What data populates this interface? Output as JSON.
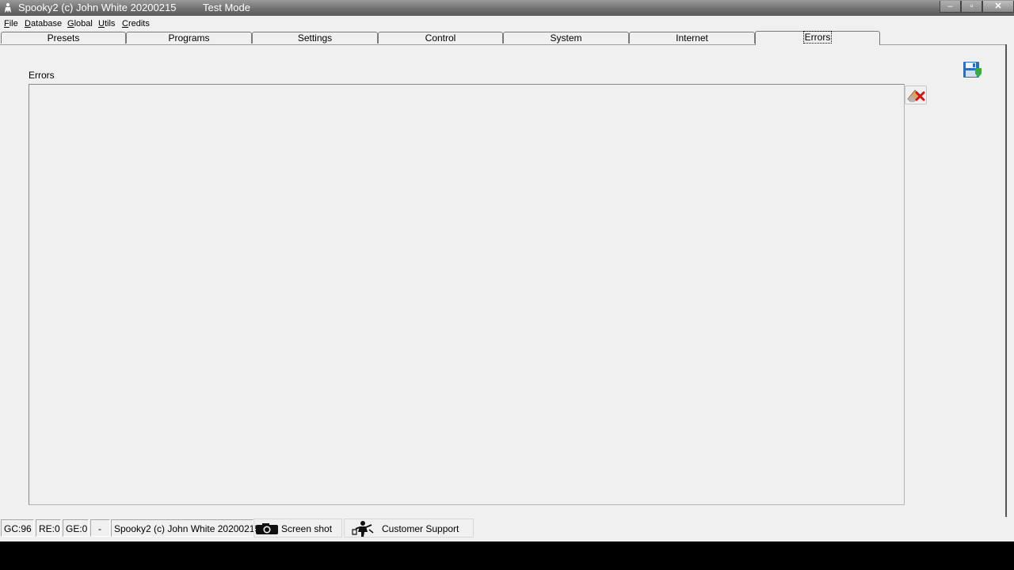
{
  "window": {
    "title": "Spooky2 (c) John White 20200215",
    "mode": "Test Mode",
    "minimize": "–",
    "maximize": "▫",
    "close": "✕"
  },
  "menu": {
    "items": [
      {
        "first": "F",
        "rest": "ile"
      },
      {
        "first": "D",
        "rest": "atabase"
      },
      {
        "first": "G",
        "rest": "lobal"
      },
      {
        "first": "U",
        "rest": "tils"
      },
      {
        "first": "C",
        "rest": "redits"
      }
    ]
  },
  "tabs": [
    {
      "label": "Presets"
    },
    {
      "label": "Programs"
    },
    {
      "label": "Settings"
    },
    {
      "label": "Control"
    },
    {
      "label": "System"
    },
    {
      "label": "Internet"
    },
    {
      "label": "Errors",
      "active": true
    }
  ],
  "errors_panel": {
    "label": "Errors",
    "save_icon": "floppy-save-icon",
    "clear_icon": "eraser-clear-icon"
  },
  "status_bar": {
    "gc": "GC:96",
    "re": "RE:0",
    "ge": "GE:0",
    "dash": "-",
    "copyright": "Spooky2 (c) John White 20200215",
    "screenshot_label": "Screen shot",
    "support_label": "Customer Support"
  }
}
